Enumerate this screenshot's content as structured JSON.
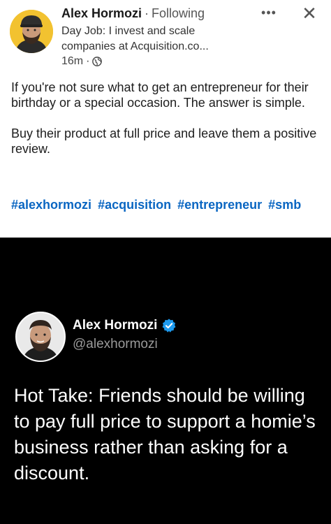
{
  "linkedin_post": {
    "author_name": "Alex Hormozi",
    "separator": "·",
    "follow_status": "Following",
    "headline": "Day Job: I invest and scale companies at Acquisition.co...",
    "time": "16m",
    "visibility_icon": "globe-icon",
    "more_icon": "more-options-icon",
    "close_glyph": "✕",
    "paragraphs": [
      "If you're not sure what to get an entrepreneur for their birthday or a special occasion. The answer is simple.",
      "Buy their product at full price and leave them a positive review."
    ],
    "hashtags": [
      "#alexhormozi",
      "#acquisition",
      "#entrepreneur",
      "#smb"
    ],
    "hashtag_color": "#0a66c2"
  },
  "tweet": {
    "name": "Alex Hormozi",
    "handle": "@alexhormozi",
    "verified_icon": "verified-badge-icon",
    "verified_color": "#1d9bf0",
    "text": "Hot Take: Friends should be willing to pay full price to support a homie’s business rather than asking for a discount.",
    "background": "#000000"
  }
}
